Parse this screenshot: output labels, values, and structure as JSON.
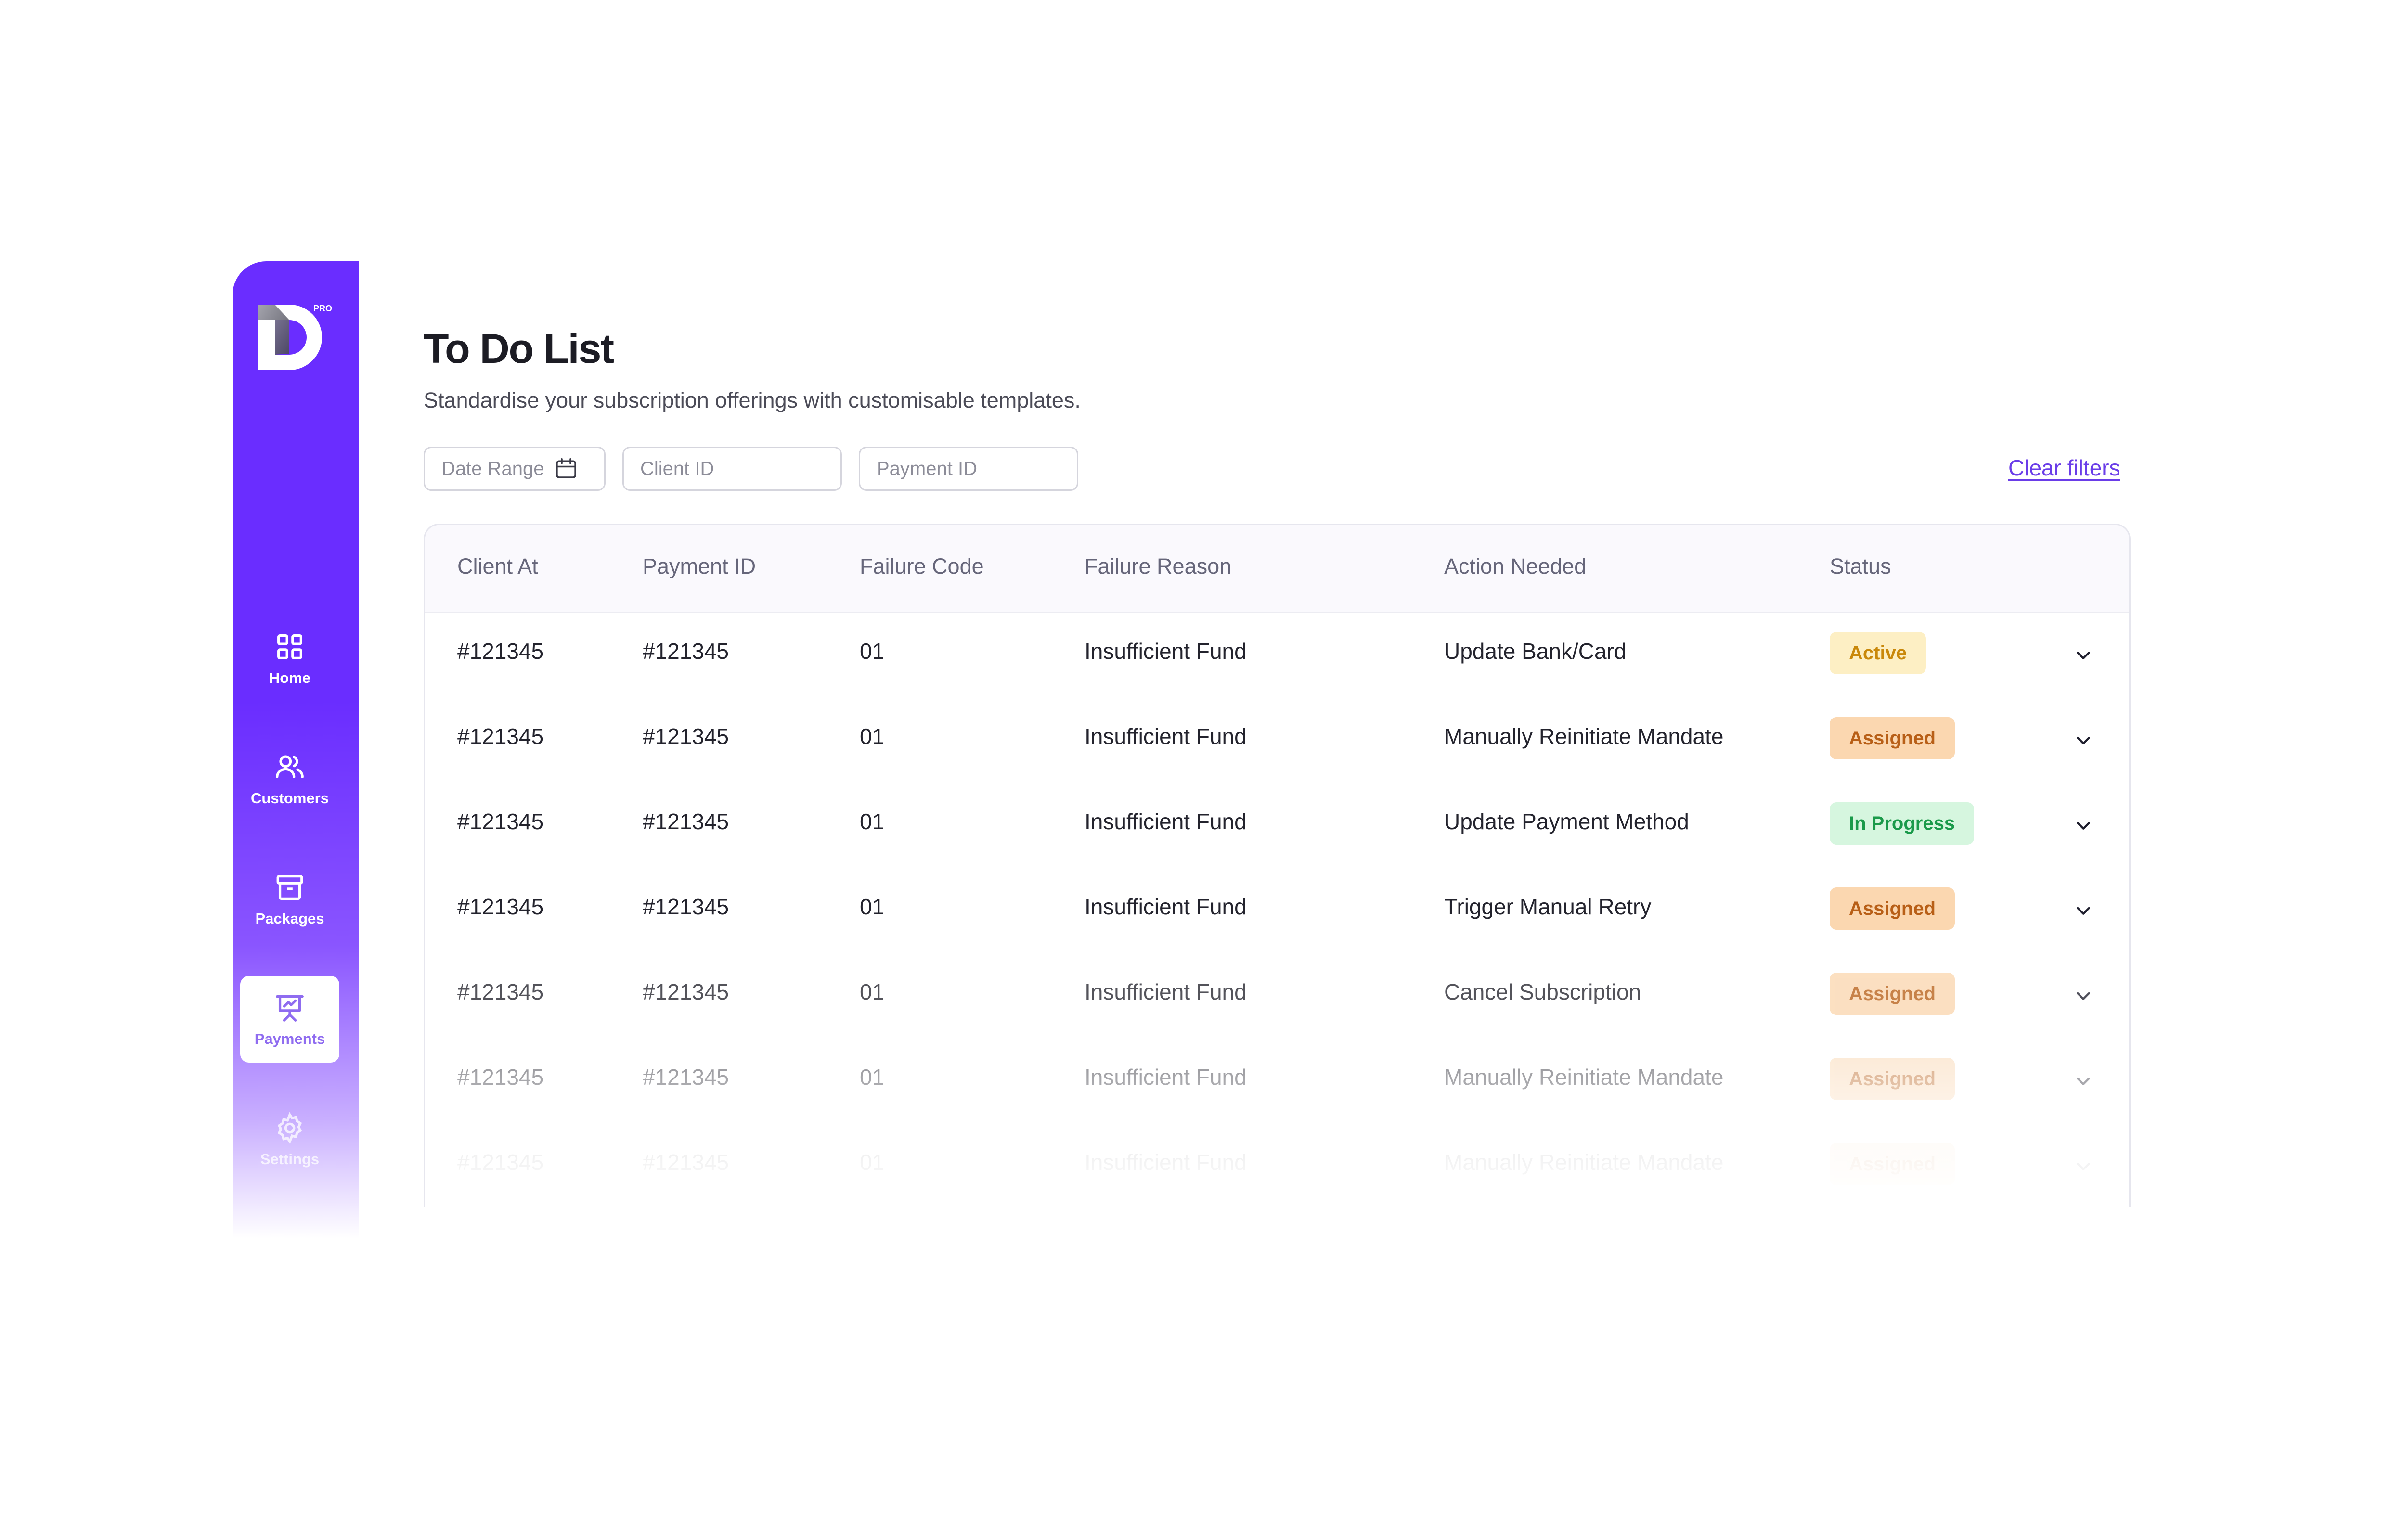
{
  "sidebar": {
    "logo_pro": "PRO",
    "items": [
      {
        "label": "Home",
        "icon": "grid-icon"
      },
      {
        "label": "Customers",
        "icon": "users-icon"
      },
      {
        "label": "Packages",
        "icon": "archive-box-icon"
      },
      {
        "label": "Payments",
        "icon": "presentation-chart-icon"
      },
      {
        "label": "Settings",
        "icon": "gear-icon"
      }
    ],
    "active_item": "Payments"
  },
  "header": {
    "title": "To Do List",
    "subtitle": "Standardise your subscription offerings with customisable templates."
  },
  "filters": {
    "date_range_placeholder": "Date Range",
    "client_id_placeholder": "Client ID",
    "payment_id_placeholder": "Payment ID",
    "clear_label": "Clear filters"
  },
  "table": {
    "columns": [
      "Client At",
      "Payment ID",
      "Failure Code",
      "Failure Reason",
      "Action Needed",
      "Status"
    ],
    "rows": [
      {
        "client": "#121345",
        "payment": "#121345",
        "code": "01",
        "reason": "Insufficient Fund",
        "action": "Update Bank/Card",
        "status": "Active",
        "status_type": "active"
      },
      {
        "client": "#121345",
        "payment": "#121345",
        "code": "01",
        "reason": "Insufficient Fund",
        "action": "Manually Reinitiate Mandate",
        "status": "Assigned",
        "status_type": "assigned"
      },
      {
        "client": "#121345",
        "payment": "#121345",
        "code": "01",
        "reason": "Insufficient Fund",
        "action": "Update Payment Method",
        "status": "In Progress",
        "status_type": "progress"
      },
      {
        "client": "#121345",
        "payment": "#121345",
        "code": "01",
        "reason": "Insufficient Fund",
        "action": "Trigger Manual Retry",
        "status": "Assigned",
        "status_type": "assigned"
      },
      {
        "client": "#121345",
        "payment": "#121345",
        "code": "01",
        "reason": "Insufficient Fund",
        "action": "Cancel Subscription",
        "status": "Assigned",
        "status_type": "assigned"
      },
      {
        "client": "#121345",
        "payment": "#121345",
        "code": "01",
        "reason": "Insufficient Fund",
        "action": "Manually Reinitiate Mandate",
        "status": "Assigned",
        "status_type": "assigned"
      },
      {
        "client": "#121345",
        "payment": "#121345",
        "code": "01",
        "reason": "Insufficient Fund",
        "action": "Manually Reinitiate Mandate",
        "status": "Assigned",
        "status_type": "assigned"
      }
    ]
  },
  "colors": {
    "brand": "#6a2dff",
    "link": "#6a3de8",
    "active_badge": "#fdefc4",
    "assigned_badge": "#fbd7b0",
    "progress_badge": "#d6f6df"
  }
}
